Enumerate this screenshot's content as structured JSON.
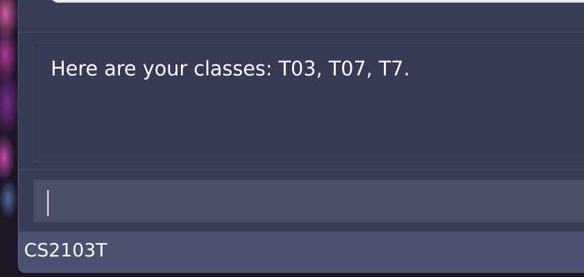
{
  "result_display": {
    "text": "Here are your classes: T03, T07, T7."
  },
  "command_box": {
    "value": "",
    "placeholder": ""
  },
  "status_bar": {
    "text": "CS2103T"
  },
  "colors": {
    "window_background": "#3b3f58",
    "result_background": "#363a52",
    "command_box_background": "#4a4e69",
    "status_bar_background": "#4d5170",
    "text": "#ffffff"
  }
}
